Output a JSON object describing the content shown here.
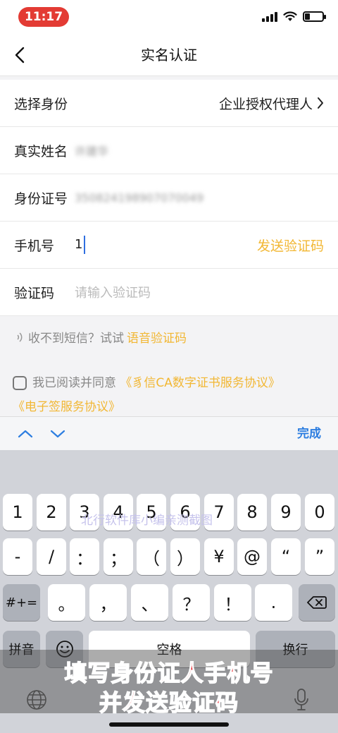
{
  "status_bar": {
    "time": "11:17"
  },
  "nav": {
    "title": "实名认证"
  },
  "form": {
    "identity": {
      "label": "选择身份",
      "value": "企业授权代理人"
    },
    "name": {
      "label": "真实姓名",
      "value": "许建华"
    },
    "id_number": {
      "label": "身份证号",
      "value": "350824198907070049"
    },
    "phone": {
      "label": "手机号",
      "value": "1",
      "action": "发送验证码"
    },
    "code": {
      "label": "验证码",
      "placeholder": "请输入验证码"
    }
  },
  "voice_tip": {
    "text": "收不到短信？试试",
    "link": "语音验证码"
  },
  "agreement": {
    "text": "我已阅读并同意",
    "link1": "《豸信CA数字证书服务协议》",
    "link2": "《电子签服务协议》"
  },
  "toolbar": {
    "done": "完成"
  },
  "keyboard": {
    "row1": [
      "1",
      "2",
      "3",
      "4",
      "5",
      "6",
      "7",
      "8",
      "9",
      "0"
    ],
    "row2": [
      "-",
      "/",
      "：",
      "；",
      "（",
      "）",
      "¥",
      "@",
      "“",
      "”"
    ],
    "row3_mode": "#+=",
    "row3": [
      "。",
      "，",
      "、",
      "？",
      "！",
      "."
    ],
    "pinyin": "拼音",
    "space": "空格",
    "return": "换行"
  },
  "watermark": "北行软件库小编亲测截图",
  "caption": {
    "line1": "填写身份证人手机号",
    "line2": "并发送验证码"
  },
  "colors": {
    "accent": "#f2b733",
    "link_blue": "#2d7ee0",
    "caption_red": "#e7262d"
  }
}
